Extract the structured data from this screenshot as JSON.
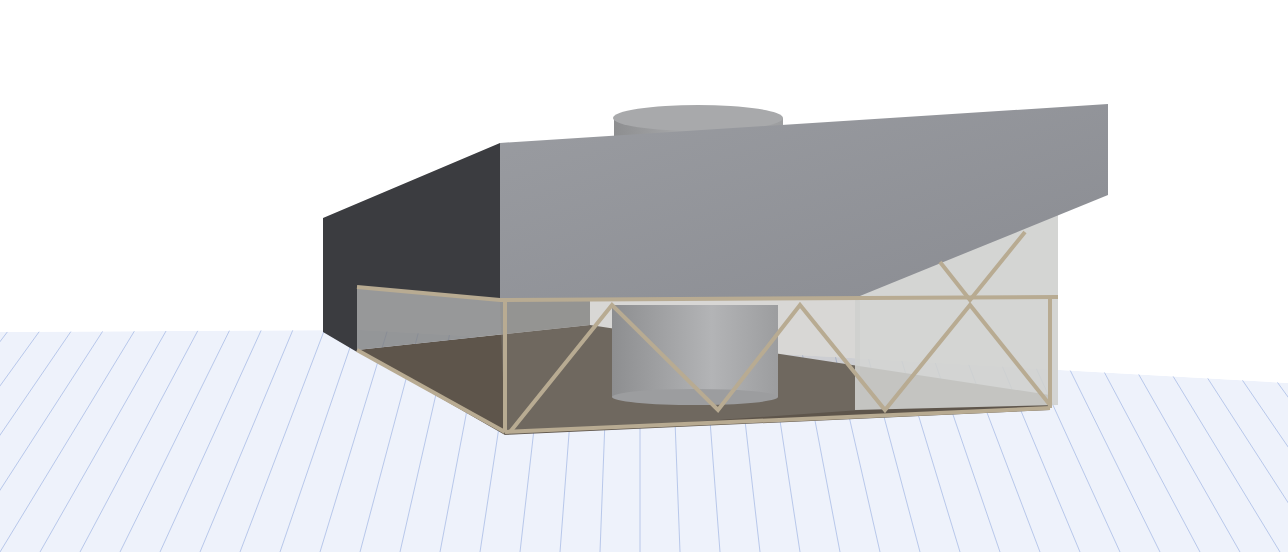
{
  "viewport": {
    "ground_grid": true
  }
}
